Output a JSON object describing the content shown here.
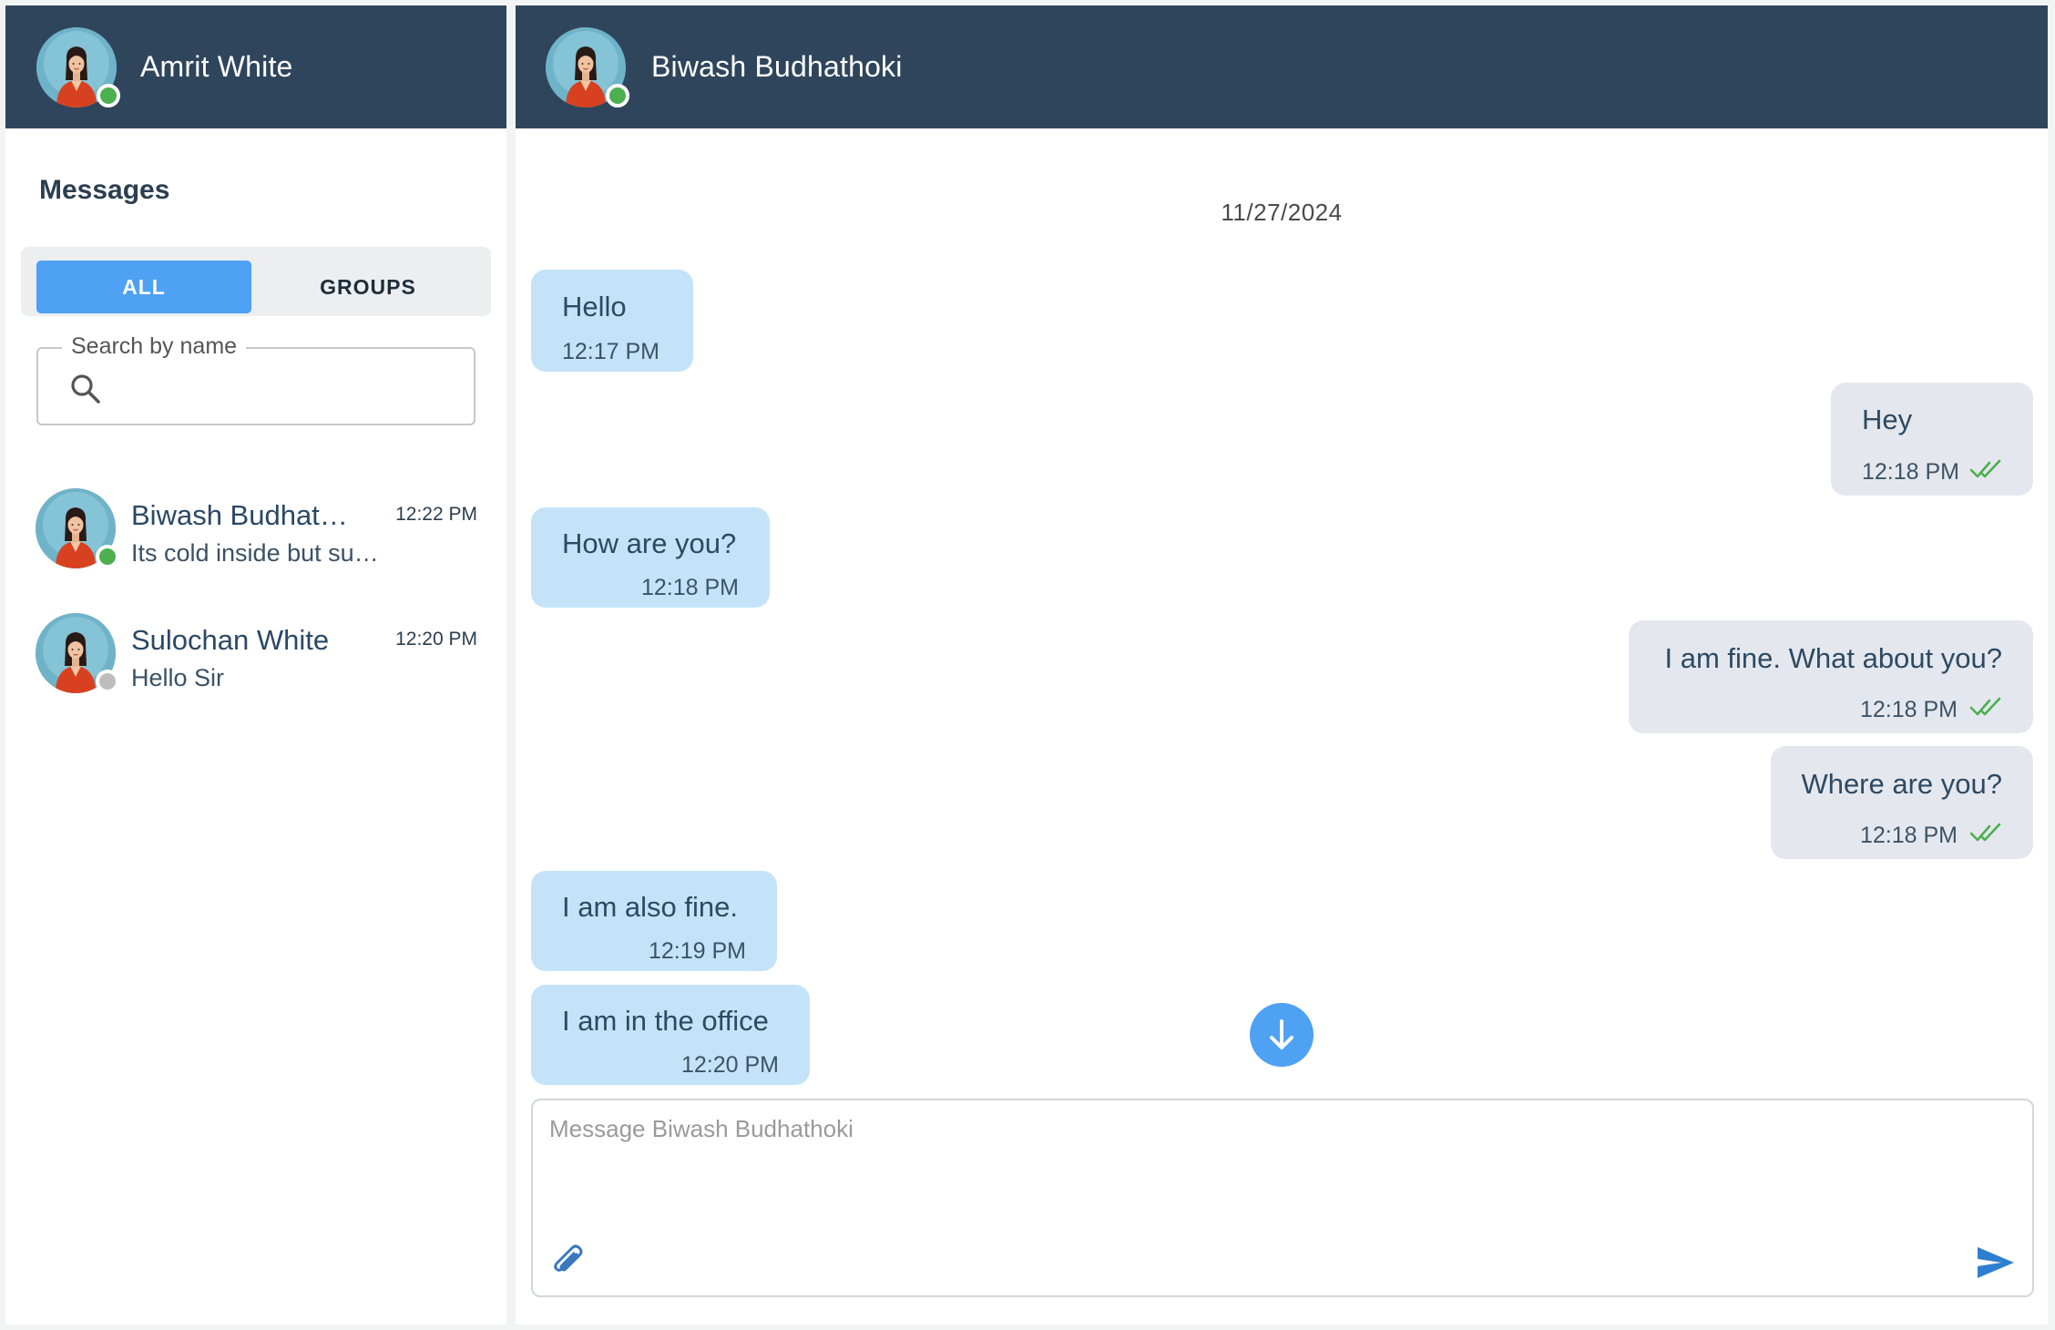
{
  "colors": {
    "header_bg": "#2f455c",
    "accent": "#4ea1f3",
    "incoming_bubble": "#c4e3f8",
    "outgoing_bubble": "#e4e8ee",
    "online": "#4caf50",
    "offline": "#bdbdbd",
    "read_check": "#4caf50"
  },
  "sidebar": {
    "current_user": {
      "name": "Amrit White",
      "status": "online"
    },
    "title": "Messages",
    "tabs": [
      {
        "label": "ALL",
        "active": true
      },
      {
        "label": "GROUPS",
        "active": false
      }
    ],
    "search": {
      "label": "Search by name",
      "value": "",
      "icon": "search-icon"
    },
    "contacts": [
      {
        "name": "Biwash Budhathoki",
        "preview": "Its cold inside but sunny outside",
        "time": "12:22 PM",
        "status": "online"
      },
      {
        "name": "Sulochan White",
        "preview": "Hello Sir",
        "time": "12:20 PM",
        "status": "offline"
      }
    ]
  },
  "chat": {
    "header": {
      "name": "Biwash Budhathoki",
      "status": "online"
    },
    "date": "11/27/2024",
    "messages": [
      {
        "direction": "in",
        "text": "Hello",
        "time": "12:17 PM"
      },
      {
        "direction": "out",
        "text": "Hey",
        "time": "12:18 PM",
        "read": true
      },
      {
        "direction": "in",
        "text": "How are you?",
        "time": "12:18 PM"
      },
      {
        "direction": "out",
        "text": "I am fine. What about you?",
        "time": "12:18 PM",
        "read": true
      },
      {
        "direction": "out",
        "text": "Where are you?",
        "time": "12:18 PM",
        "read": true
      },
      {
        "direction": "in",
        "text": "I am also fine.",
        "time": "12:19 PM"
      },
      {
        "direction": "in",
        "text": "I am in the office",
        "time": "12:20 PM"
      }
    ],
    "composer": {
      "placeholder": "Message Biwash Budhathoki",
      "value": "",
      "attach_icon": "paperclip-icon",
      "send_icon": "send-icon"
    },
    "scroll_down_icon": "arrow-down-icon"
  }
}
